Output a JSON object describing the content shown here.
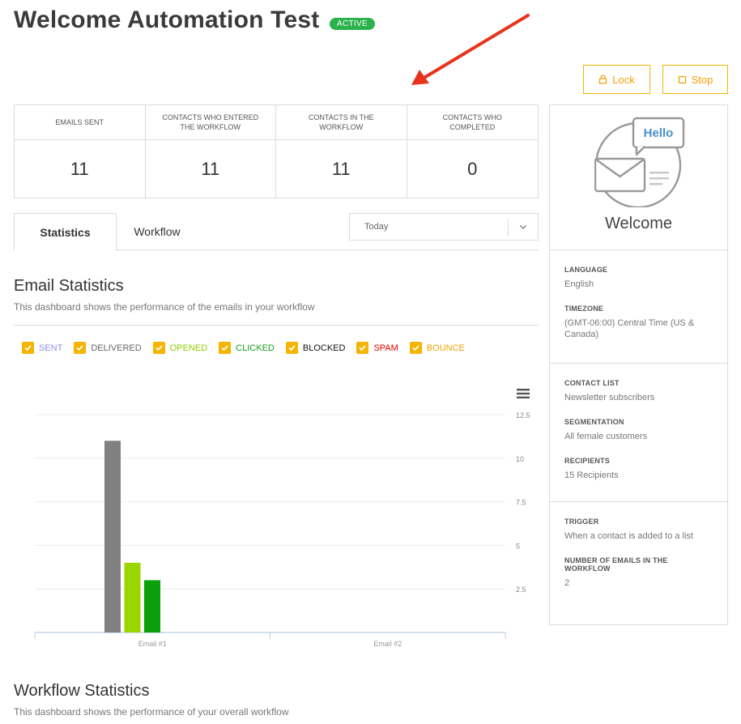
{
  "header": {
    "title": "Welcome Automation Test",
    "status": "ACTIVE",
    "lock_label": "Lock",
    "stop_label": "Stop"
  },
  "stats": [
    {
      "label": "EMAILS SENT",
      "value": "11"
    },
    {
      "label": "CONTACTS WHO ENTERED THE WORKFLOW",
      "value": "11"
    },
    {
      "label": "CONTACTS IN THE WORKFLOW",
      "value": "11"
    },
    {
      "label": "CONTACTS WHO COMPLETED",
      "value": "0"
    }
  ],
  "tabs": [
    {
      "label": "Statistics",
      "active": true
    },
    {
      "label": "Workflow",
      "active": false
    }
  ],
  "date_select": {
    "value": "Today"
  },
  "email_stats": {
    "title": "Email Statistics",
    "subtitle": "This dashboard shows the performance of the emails in your workflow"
  },
  "legend": [
    {
      "label": "SENT",
      "color": "#8f8fe6"
    },
    {
      "label": "DELIVERED",
      "color": "#666666"
    },
    {
      "label": "OPENED",
      "color": "#8fce00"
    },
    {
      "label": "CLICKED",
      "color": "#1a9e1a"
    },
    {
      "label": "BLOCKED",
      "color": "#111111"
    },
    {
      "label": "SPAM",
      "color": "#e60000"
    },
    {
      "label": "BOUNCE",
      "color": "#f4a000"
    }
  ],
  "chart_data": {
    "type": "bar",
    "categories": [
      "Email #1",
      "Email #2"
    ],
    "series": [
      {
        "name": "DELIVERED",
        "color": "#808080",
        "values": [
          11,
          0
        ]
      },
      {
        "name": "OPENED",
        "color": "#99d600",
        "values": [
          4,
          0
        ]
      },
      {
        "name": "CLICKED",
        "color": "#0aa00a",
        "values": [
          3,
          0
        ]
      }
    ],
    "y_ticks": [
      "2.5",
      "5",
      "7.5",
      "10",
      "12.5"
    ],
    "ylim": [
      0,
      12.5
    ],
    "y_axis_side": "right",
    "grid": true
  },
  "workflow_stats": {
    "title": "Workflow Statistics",
    "subtitle": "This dashboard shows the performance of your overall workflow"
  },
  "side": {
    "hero_bubble": "Hello",
    "hero_title": "Welcome",
    "language_label": "LANGUAGE",
    "language": "English",
    "timezone_label": "TIMEZONE",
    "timezone": "(GMT-06:00) Central Time (US & Canada)",
    "contact_list_label": "CONTACT LIST",
    "contact_list": "Newsletter subscribers",
    "segmentation_label": "SEGMENTATION",
    "segmentation": "All female customers",
    "recipients_label": "RECIPIENTS",
    "recipients": "15 Recipients",
    "trigger_label": "TRIGGER",
    "trigger": "When a contact is added to a list",
    "num_emails_label": "NUMBER OF EMAILS IN THE WORKFLOW",
    "num_emails": "2"
  },
  "colors": {
    "accent": "#f4b400",
    "active_badge": "#2bb24c",
    "annotation_arrow": "#e8341c"
  }
}
